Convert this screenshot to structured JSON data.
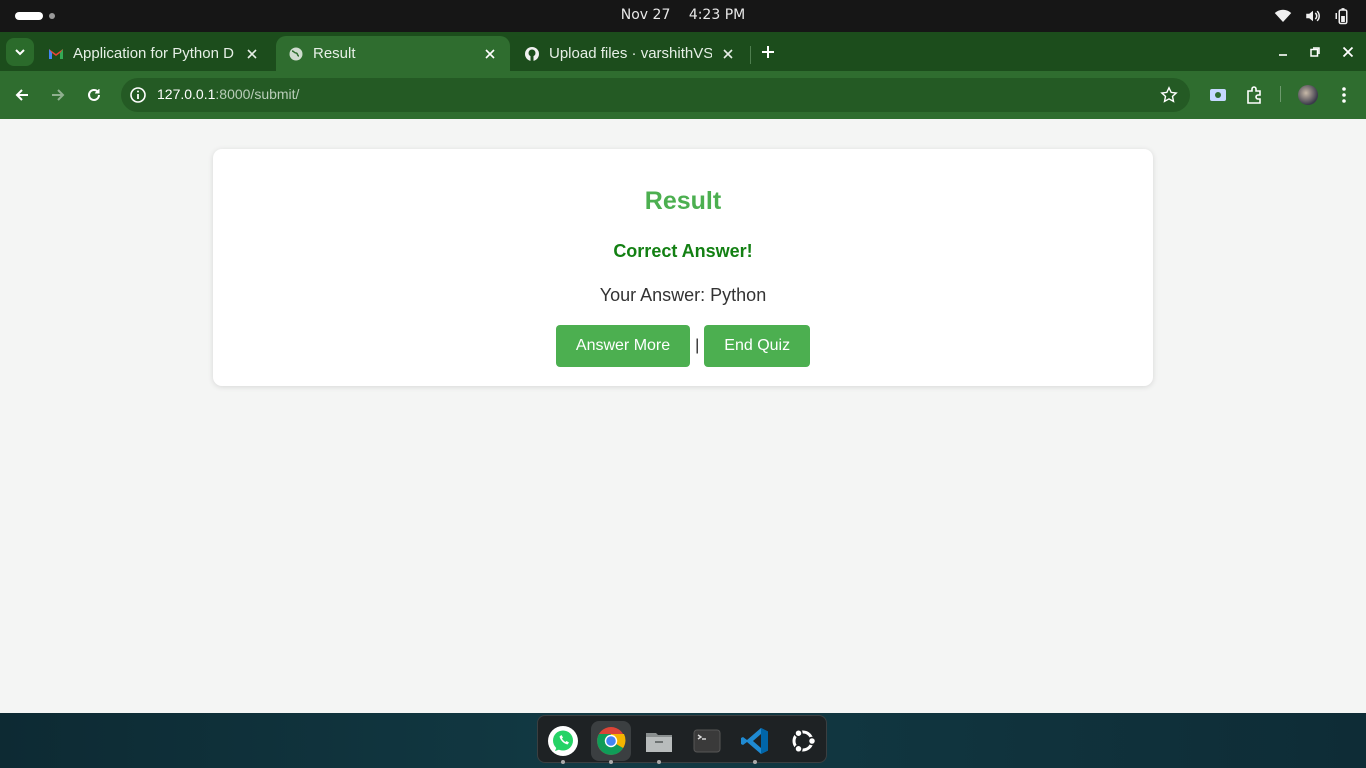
{
  "system": {
    "date": "Nov 27",
    "time": "4:23 PM"
  },
  "tabs": [
    {
      "title": "Application for Python D",
      "favicon": "gmail-icon"
    },
    {
      "title": "Result",
      "favicon": "globe-icon"
    },
    {
      "title": "Upload files · varshithVS/",
      "favicon": "github-icon"
    }
  ],
  "address_bar": {
    "host": "127.0.0.1",
    "path": ":8000/submit/"
  },
  "result": {
    "heading": "Result",
    "verdict": "Correct Answer!",
    "answer_line": "Your Answer: Python",
    "answer_more_label": "Answer More",
    "separator": "|",
    "end_quiz_label": "End Quiz"
  },
  "colors": {
    "accent_green": "#4caf50",
    "verdict_green": "#138013",
    "chrome_theme": "#2f6d2f"
  },
  "dock": [
    "whatsapp-icon",
    "chrome-icon",
    "files-icon",
    "terminal-icon",
    "vscode-icon",
    "ubuntu-icon"
  ]
}
